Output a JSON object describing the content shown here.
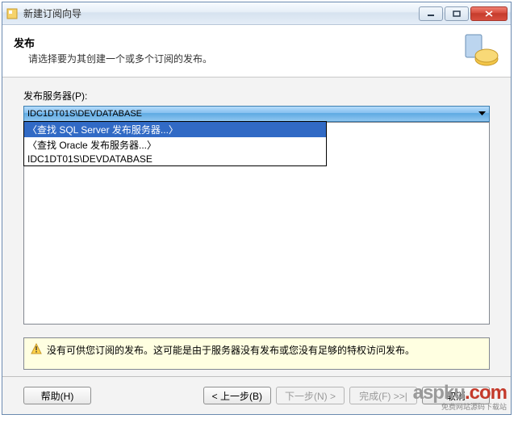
{
  "window": {
    "title": "新建订阅向导"
  },
  "header": {
    "title": "发布",
    "subtitle": "请选择要为其创建一个或多个订阅的发布。"
  },
  "publisher": {
    "label": "发布服务器(P):",
    "selected": "IDC1DT01S\\DEVDATABASE",
    "options": [
      "〈查找 SQL Server 发布服务器...〉",
      "〈查找 Oracle 发布服务器...〉",
      "IDC1DT01S\\DEVDATABASE"
    ],
    "selected_option_index": 0
  },
  "warning": {
    "text": "没有可供您订阅的发布。这可能是由于服务器没有发布或您没有足够的特权访问发布。"
  },
  "buttons": {
    "help": "帮助(H)",
    "back": "< 上一步(B)",
    "next": "下一步(N) >",
    "finish": "完成(F) >>|",
    "cancel": "取消"
  },
  "watermark": {
    "main": "aspku",
    "dotcom": ".com",
    "tagline": "免费网站源码下载站"
  }
}
